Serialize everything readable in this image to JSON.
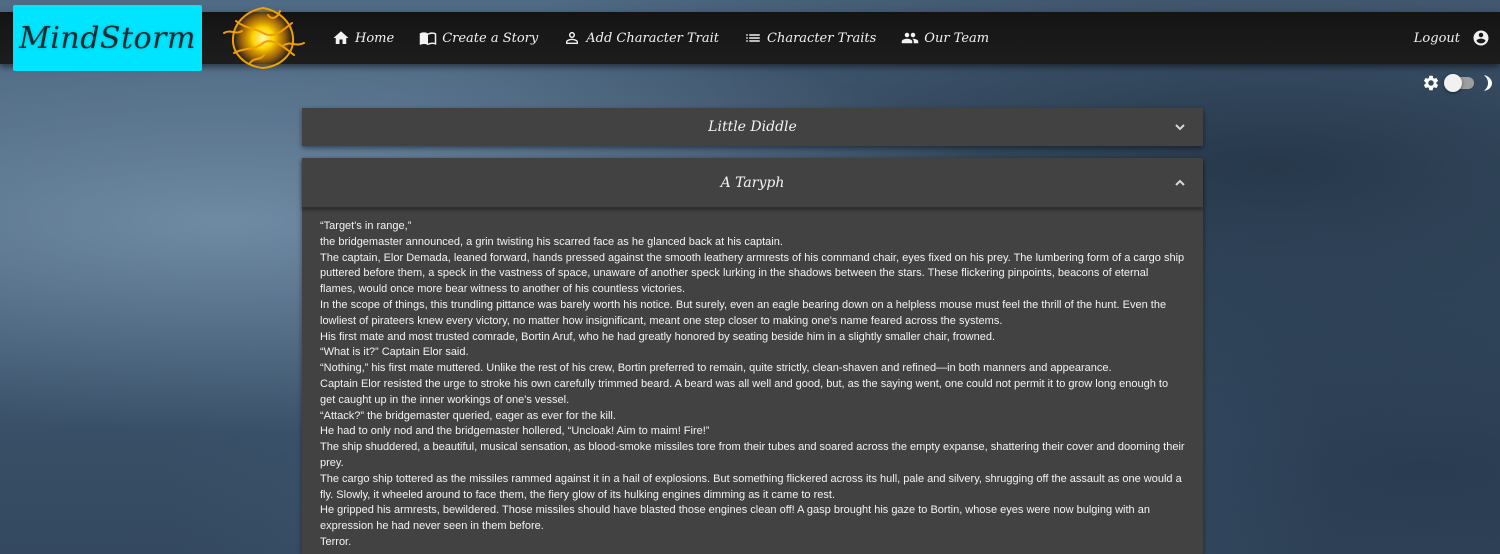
{
  "brand": {
    "name": "MindStorm"
  },
  "nav": {
    "items": [
      {
        "label": "Home",
        "icon": "home-icon"
      },
      {
        "label": "Create a Story",
        "icon": "book-icon"
      },
      {
        "label": "Add Character Trait",
        "icon": "person-icon"
      },
      {
        "label": "Character Traits",
        "icon": "list-icon"
      },
      {
        "label": "Our Team",
        "icon": "group-icon"
      }
    ],
    "logout_label": "Logout"
  },
  "theme": {
    "dark_mode_on": false
  },
  "stories": [
    {
      "title": "Little Diddle",
      "expanded": false
    },
    {
      "title": "A Taryph",
      "expanded": true,
      "paragraphs": [
        "“Target's in range,”",
        "the bridgemaster announced, a grin twisting his scarred face as he glanced back at his captain.",
        "The captain, Elor Demada, leaned forward, hands pressed against the smooth leathery armrests of his command chair, eyes fixed on his prey. The lumbering form of a cargo ship puttered before them, a speck in the vastness of space, unaware of another speck lurking in the shadows between the stars. These flickering pinpoints, beacons of eternal flames, would once more bear witness to another of his countless victories.",
        "In the scope of things, this trundling pittance was barely worth his notice. But surely, even an eagle bearing down on a helpless mouse must feel the thrill of the hunt. Even the lowliest of pirateers knew every victory, no matter how insignificant, meant one step closer to making one's name feared across the systems.",
        "His first mate and most trusted comrade, Bortin Aruf, who he had greatly honored by seating beside him in a slightly smaller chair, frowned.",
        "“What is it?” Captain Elor said.",
        "“Nothing,” his first mate muttered. Unlike the rest of his crew, Bortin preferred to remain, quite strictly, clean-shaven and refined—in both manners and appearance.",
        "Captain Elor resisted the urge to stroke his own carefully trimmed beard. A beard was all well and good, but, as the saying went, one could not permit it to grow long enough to get caught up in the inner workings of one's vessel.",
        "“Attack?” the bridgemaster queried, eager as ever for the kill.",
        "He had to only nod and the bridgemaster hollered, “Uncloak! Aim to maim! Fire!”",
        "The ship shuddered, a beautiful, musical sensation, as blood-smoke missiles tore from their tubes and soared across the empty expanse, shattering their cover and dooming their prey.",
        "The cargo ship tottered as the missiles rammed against it in a hail of explosions. But something flickered across its hull, pale and silvery, shrugging off the assault as one would a fly. Slowly, it wheeled around to face them, the fiery glow of its hulking engines dimming as it came to rest.",
        "He gripped his armrests, bewildered. Those missiles should have blasted those engines clean off! A gasp brought his gaze to Bortin, whose eyes were now bulging with an expression he had never seen in them before.",
        "Terror."
      ]
    }
  ]
}
